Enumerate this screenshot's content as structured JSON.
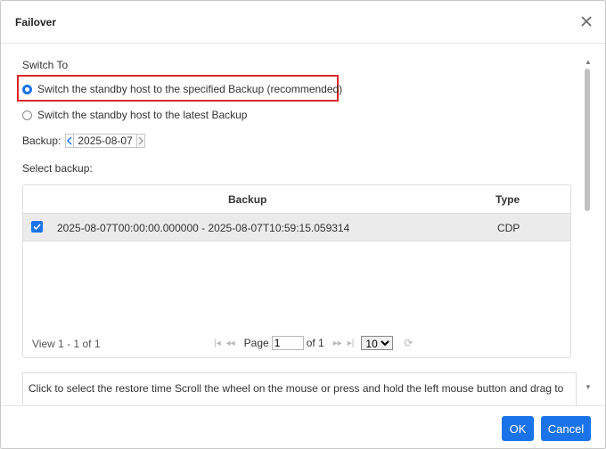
{
  "dialog": {
    "title": "Failover"
  },
  "switch_to": {
    "label": "Switch To",
    "options": [
      {
        "label": "Switch the standby host to the specified Backup (recommended)",
        "checked": true
      },
      {
        "label": "Switch the standby host to the latest Backup",
        "checked": false
      }
    ]
  },
  "backup": {
    "label": "Backup:",
    "date": "2025-08-07"
  },
  "select_backup": {
    "label": "Select backup:",
    "columns": {
      "backup": "Backup",
      "type": "Type"
    },
    "rows": [
      {
        "backup": "2025-08-07T00:00:00.000000 - 2025-08-07T10:59:15.059314",
        "type": "CDP",
        "checked": true
      }
    ],
    "pager": {
      "view": "View 1 - 1 of 1",
      "page_label": "Page",
      "page_value": "1",
      "of_label": "of 1",
      "page_size": "10"
    }
  },
  "timeline": {
    "hint": "Click to select the restore time   Scroll the wheel on the mouse or press and hold the left mouse button and drag to"
  },
  "footer": {
    "ok": "OK",
    "cancel": "Cancel"
  },
  "colors": {
    "accent": "#1a73e8",
    "highlight": "#d9262c"
  }
}
